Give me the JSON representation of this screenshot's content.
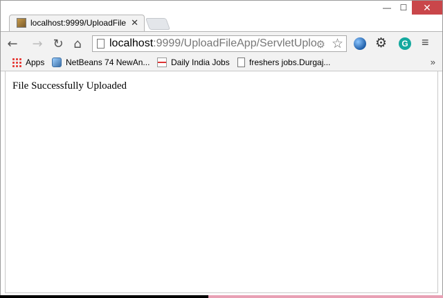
{
  "window": {
    "minimize_glyph": "—",
    "maximize_glyph": "☐",
    "close_glyph": "✕"
  },
  "tab": {
    "title": "localhost:9999/UploadFile",
    "close_glyph": "✕"
  },
  "toolbar": {
    "back_glyph": "←",
    "forward_glyph": "→",
    "reload_glyph": "↻",
    "home_glyph": "⌂",
    "url_host": "localhost",
    "url_rest": ":9999/UploadFileApp/ServletUplo",
    "star_glyph": "☆",
    "gear_glyph": "⚙",
    "grammarly_glyph": "G",
    "menu_glyph": "≡"
  },
  "bookmarks": {
    "items": [
      {
        "label": "Apps",
        "icon": "apps-icon"
      },
      {
        "label": "NetBeans 74 NewAn...",
        "icon": "cube-icon"
      },
      {
        "label": "Daily India Jobs",
        "icon": "jobs-icon"
      },
      {
        "label": "freshers jobs.Durgaj...",
        "icon": "document-icon"
      }
    ],
    "overflow_glyph": "»"
  },
  "content": {
    "message": "File Successfully Uploaded"
  },
  "colors": {
    "close_button": "#c9464a",
    "toolbar_bg": "#f2f2f2"
  }
}
